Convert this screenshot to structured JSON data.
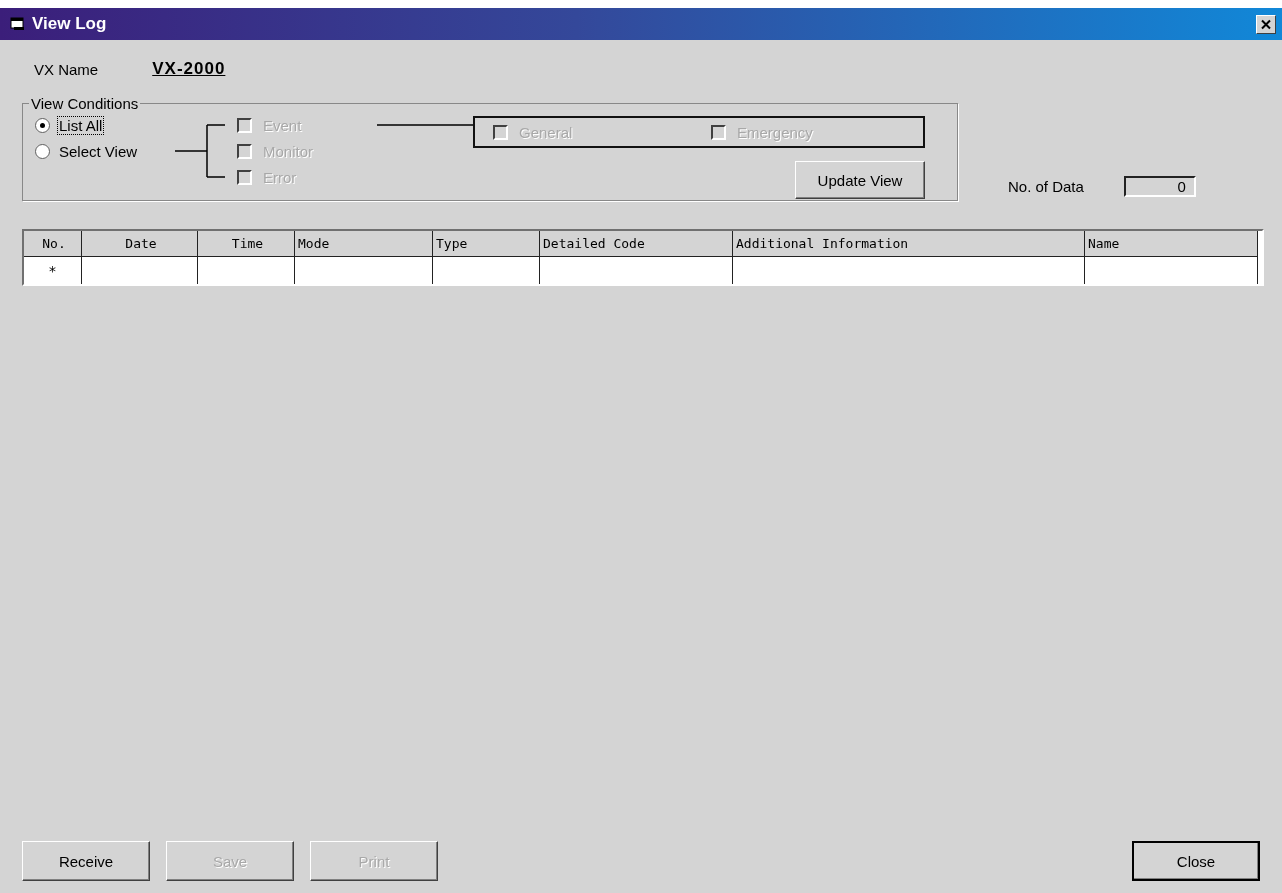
{
  "window": {
    "title": "View Log"
  },
  "vx_name": {
    "label": "VX Name",
    "value": "VX-2000"
  },
  "view_conditions": {
    "title": "View Conditions",
    "options": [
      {
        "label": "List All",
        "selected": true
      },
      {
        "label": "Select View",
        "selected": false
      }
    ],
    "categories": [
      {
        "label": "Event",
        "checked": false,
        "disabled": true
      },
      {
        "label": "Monitor",
        "checked": false,
        "disabled": true
      },
      {
        "label": "Error",
        "checked": false,
        "disabled": true
      }
    ],
    "subtypes": [
      {
        "label": "General",
        "checked": false,
        "disabled": true
      },
      {
        "label": "Emergency",
        "checked": false,
        "disabled": true
      }
    ],
    "update_button": "Update View"
  },
  "data_count": {
    "label": "No. of Data",
    "value": "0"
  },
  "table": {
    "columns": [
      "No.",
      "Date",
      "Time",
      "Mode",
      "Type",
      "Detailed Code",
      "Additional Information",
      "Name"
    ],
    "new_row_marker": "*"
  },
  "buttons": [
    {
      "label": "Receive",
      "disabled": false
    },
    {
      "label": "Save",
      "disabled": true
    },
    {
      "label": "Print",
      "disabled": true
    }
  ],
  "close_button": "Close"
}
